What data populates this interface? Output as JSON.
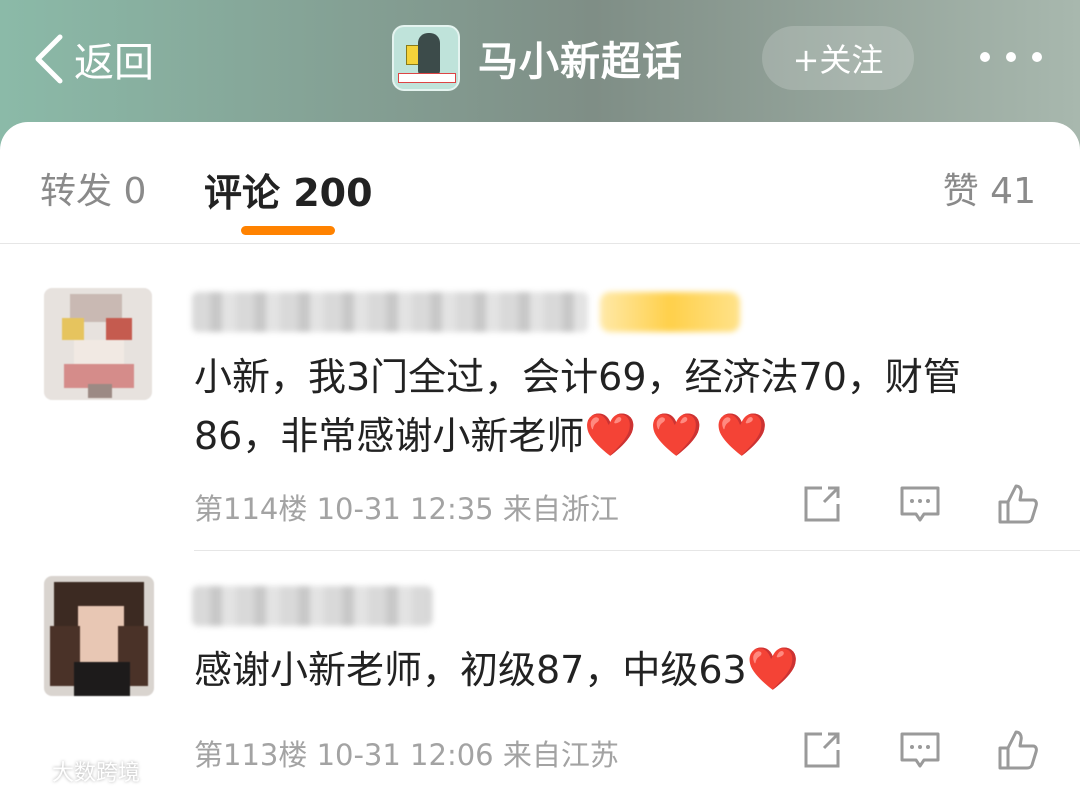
{
  "header": {
    "back_label": "返回",
    "topic_name": "马小新超话",
    "follow_label": "+关注"
  },
  "tabs": {
    "repost": "转发 0",
    "comments": "评论 200",
    "likes": "赞 41"
  },
  "comments": [
    {
      "text": "小新，我3门全过，会计69，经济法70，财管86，非常感谢小新老师",
      "hearts": "❤️ ❤️ ❤️",
      "meta": "第114楼 10-31 12:35 来自浙江"
    },
    {
      "text": "感谢小新老师，初级87，中级63",
      "hearts": "❤️",
      "meta": "第113楼 10-31 12:06 来自江苏"
    }
  ],
  "watermark": "大数跨境",
  "colors": {
    "accent": "#ff8200",
    "heart": "#e8182f"
  }
}
